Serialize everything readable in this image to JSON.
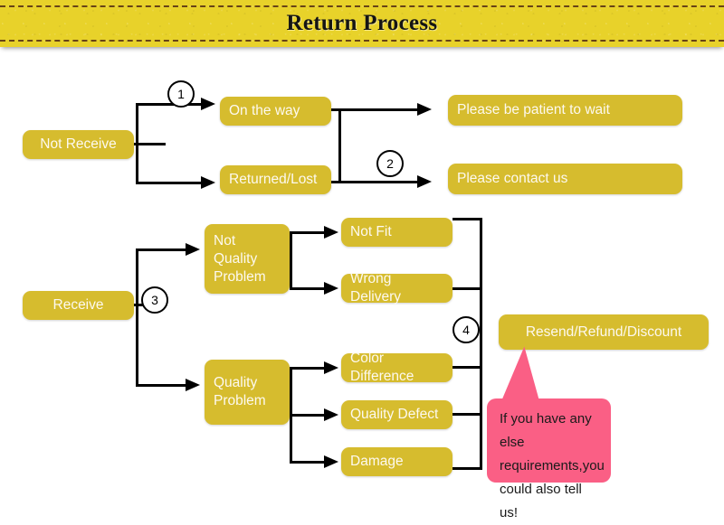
{
  "header": {
    "title": "Return Process",
    "banner_color": "#e8d22a",
    "dash_color": "#5a3414"
  },
  "theme": {
    "node_fill": "#d6bc2e",
    "node_text": "#fdf9ef",
    "line_color": "#000000",
    "callout_fill": "#fa5f85",
    "callout_text": "#1a1a1a"
  },
  "flow": {
    "roots": [
      {
        "id": "not-receive",
        "label": "Not Receive"
      },
      {
        "id": "receive",
        "label": "Receive"
      }
    ],
    "steps": [
      {
        "id": "step-1",
        "label": "1"
      },
      {
        "id": "step-2",
        "label": "2"
      },
      {
        "id": "step-3",
        "label": "3"
      },
      {
        "id": "step-4",
        "label": "4"
      }
    ],
    "not_receive_branch": {
      "conditions": [
        {
          "id": "on-the-way",
          "label": "On the way"
        },
        {
          "id": "returned-lost",
          "label": "Returned/Lost"
        }
      ],
      "outcomes": [
        {
          "id": "please-be-patient-to-wait",
          "label": "Please be patient to wait"
        },
        {
          "id": "please-contact-us",
          "label": "Please contact us"
        }
      ]
    },
    "receive_branch": {
      "categories": [
        {
          "id": "not-quality-problem",
          "label": "Not\nQuality\nProblem"
        },
        {
          "id": "quality-problem",
          "label": "Quality\nProblem"
        }
      ],
      "reasons_not_quality": [
        {
          "id": "not-fit",
          "label": "Not Fit"
        },
        {
          "id": "wrong-delivery",
          "label": "Wrong Delivery"
        }
      ],
      "reasons_quality": [
        {
          "id": "color-difference",
          "label": "Color Difference"
        },
        {
          "id": "quality-defect",
          "label": "Quality Defect"
        },
        {
          "id": "damage",
          "label": "Damage"
        }
      ],
      "resolution": {
        "id": "resend-refund-discount",
        "label": "Resend/Refund/Discount"
      }
    }
  },
  "callout": {
    "text": "If you have any else\nrequirements,you\ncould also tell us!"
  }
}
